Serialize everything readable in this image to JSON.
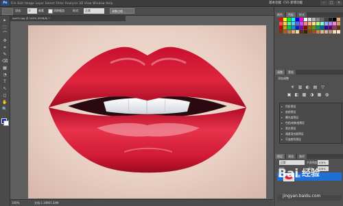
{
  "app": {
    "logo_text": "Ps",
    "menu_text": "File  Edit  Image  Layer  Select  Filter  Analysis  3D  View  Window  Help",
    "workspace_label": "基本功能",
    "cs_live_label": "CS5 新增功能",
    "window_buttons": [
      "–",
      "□",
      "×"
    ]
  },
  "options_bar": {
    "style_label": "羽化:",
    "size_label": "像素",
    "size_value": "0",
    "antialias_label": "消除锯齿",
    "mode_label": "样式:",
    "mode_value": "正常",
    "refine_label": "调整边缘..."
  },
  "toolbox": {
    "tools": [
      "▸",
      "⬚",
      "⌒",
      "✣",
      "⌗",
      "✎",
      "⌫",
      "▦",
      "◔",
      "T",
      "↖",
      "◻",
      "✋",
      "🔍"
    ],
    "fg_color": "#0018c8",
    "bg_color": "#ffffff"
  },
  "document": {
    "tab_title": "lips01.jpg @ 100% (RGB/8) *",
    "zoom": "100%",
    "doc_info": "文档:1.34M/1.34M"
  },
  "panels": {
    "top_tabs": [
      "颜色",
      "色板",
      "样式"
    ],
    "adjust_tabs": [
      "调整",
      "蒙版"
    ],
    "adjust_title": "添加调整",
    "adjust_icons_row1": [
      "☀",
      "▥",
      "◐",
      "▤",
      "▽"
    ],
    "adjust_icons_row2": [
      "▣",
      "◧",
      "▩",
      "◑",
      "▦",
      "◍"
    ],
    "presets": [
      "色阶预设",
      "曲线预设",
      "曝光度预设",
      "色相/饱和度预设",
      "黑白预设",
      "通道混合器预设",
      "可选颜色预设"
    ],
    "layers_tabs": [
      "图层",
      "通道",
      "路径"
    ],
    "blend_mode": "正常",
    "opacity_label": "不透明度:",
    "opacity_value": "100%",
    "lock_label": "锁定:",
    "fill_label": "填充:",
    "fill_value": "100%",
    "layer_name": "背景",
    "layer_eye": "●"
  },
  "colors": {
    "swatches": [
      "#ff0000",
      "#ffff00",
      "#00ff00",
      "#00ffff",
      "#0000ff",
      "#ff00ff",
      "#ffffff",
      "#d9d9d9",
      "#b3b3b3",
      "#8c8c8c",
      "#666666",
      "#404040",
      "#1a1a1a",
      "#000000",
      "#f4a460",
      "#ff4d4d",
      "#ffd24d",
      "#4dff88",
      "#4dd2ff",
      "#4d6bff",
      "#c94dff",
      "#ff8080",
      "#ffb380",
      "#ffe680",
      "#b3ff80",
      "#80ffd9",
      "#80b3ff",
      "#b380ff",
      "#ff80d9",
      "#cc9966",
      "#cc0000",
      "#cc9900",
      "#00cc44",
      "#0099cc",
      "#0022cc",
      "#8800cc",
      "#990000",
      "#996600",
      "#669900",
      "#009966",
      "#006699",
      "#330099",
      "#660066",
      "#993366",
      "#663300",
      "#7a3b00",
      "#a06030",
      "#c08040",
      "#e0b070",
      "#f0d8a0",
      "#5a2d0c",
      "#3b1f05",
      "#8b4513",
      "#a0522d",
      "#cd853f",
      "#deb887",
      "#d2b48c",
      "#bc8f8f",
      "#f5deb3",
      "#ffe4c4"
    ]
  },
  "watermark": {
    "logo": "Bai",
    "text": "经验",
    "url": "jingyan.baidu.com"
  }
}
